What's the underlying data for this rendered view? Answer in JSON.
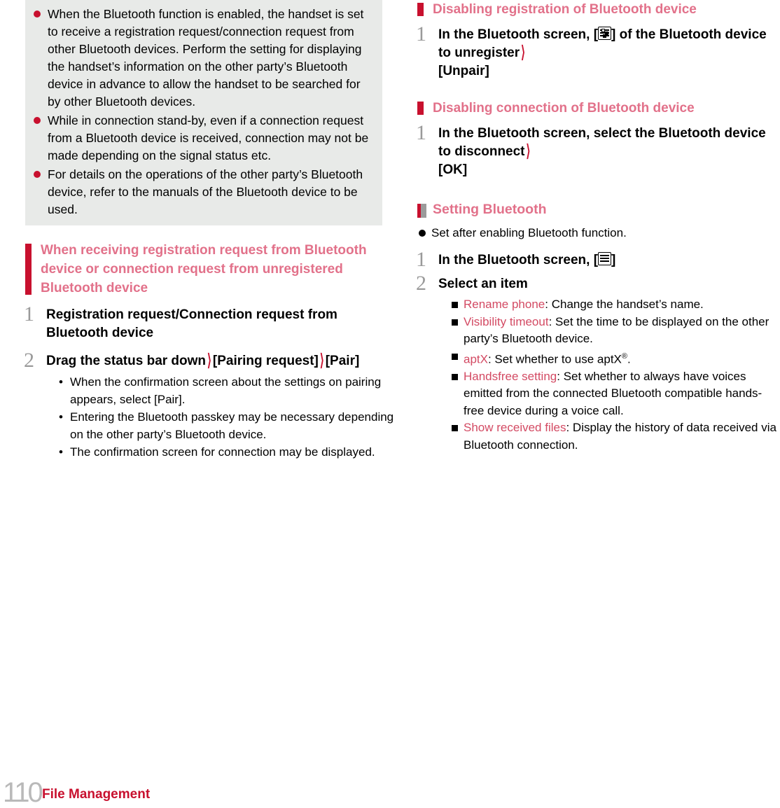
{
  "left": {
    "notes": [
      "When the Bluetooth function is enabled, the handset is set to receive a registration request/connection request from other Bluetooth devices. Perform the setting for displaying the handset’s information on the other party’s Bluetooth device in advance to allow the handset to be searched for by other Bluetooth devices.",
      "While in connection stand-by, even if a connection request from a Bluetooth device is received, connection may not be made depending on the signal status etc.",
      "For details on the operations of the other party’s Bluetooth device, refer to the manuals of the Bluetooth device to be used."
    ],
    "section_heading": "When receiving registration request from Bluetooth device or connection request from unregistered Bluetooth device",
    "steps": [
      {
        "num": "1",
        "text": "Registration request/Connection request from Bluetooth device"
      },
      {
        "num": "2",
        "text_a": "Drag the status bar down",
        "text_b": "[Pairing request]",
        "text_c": "[Pair]"
      }
    ],
    "step2_bullets": [
      "When the confirmation screen about the settings on pairing appears, select [Pair].",
      "Entering the Bluetooth passkey may be necessary depending on the other party’s Bluetooth device.",
      "The confirmation screen for connection may be displayed."
    ]
  },
  "right": {
    "section1": {
      "heading": "Disabling registration of Bluetooth device",
      "step_num": "1",
      "text_a": "In the Bluetooth screen, [",
      "text_b": "] of the Bluetooth device to unregister",
      "text_c": "[Unpair]",
      "icon": "settings-sliders-icon"
    },
    "section2": {
      "heading": "Disabling connection of Bluetooth device",
      "step_num": "1",
      "text_a": "In the Bluetooth screen, select the Bluetooth device to disconnect",
      "text_c": "[OK]"
    },
    "section3": {
      "heading": "Setting Bluetooth",
      "note": "Set after enabling Bluetooth function.",
      "step1_num": "1",
      "step1_a": "In the Bluetooth screen, [",
      "step1_b": "]",
      "step1_icon": "menu-lines-icon",
      "step2_num": "2",
      "step2_text": "Select an item",
      "items": [
        {
          "key": "Rename phone",
          "desc": ": Change the handset’s name."
        },
        {
          "key": "Visibility timeout",
          "desc": ": Set the time to be displayed on the other party’s Bluetooth device."
        },
        {
          "key": "aptX",
          "desc": ": Set whether to use aptX",
          "sup": "®",
          "desc2": "."
        },
        {
          "key": "Handsfree setting",
          "desc": ": Set whether to always have voices emitted from the connected Bluetooth compatible hands-free device during a voice call."
        },
        {
          "key": "Show received files",
          "desc": ": Display the history of data received via Bluetooth connection."
        }
      ]
    }
  },
  "footer": {
    "page_number": "110",
    "title": "File Management"
  },
  "colors": {
    "accent_red": "#c8102e",
    "heading_pink": "#e2718a",
    "keyword_pink": "#d34a63",
    "note_bg": "#e8eae8",
    "page_num_grey": "#b9b9b9"
  }
}
